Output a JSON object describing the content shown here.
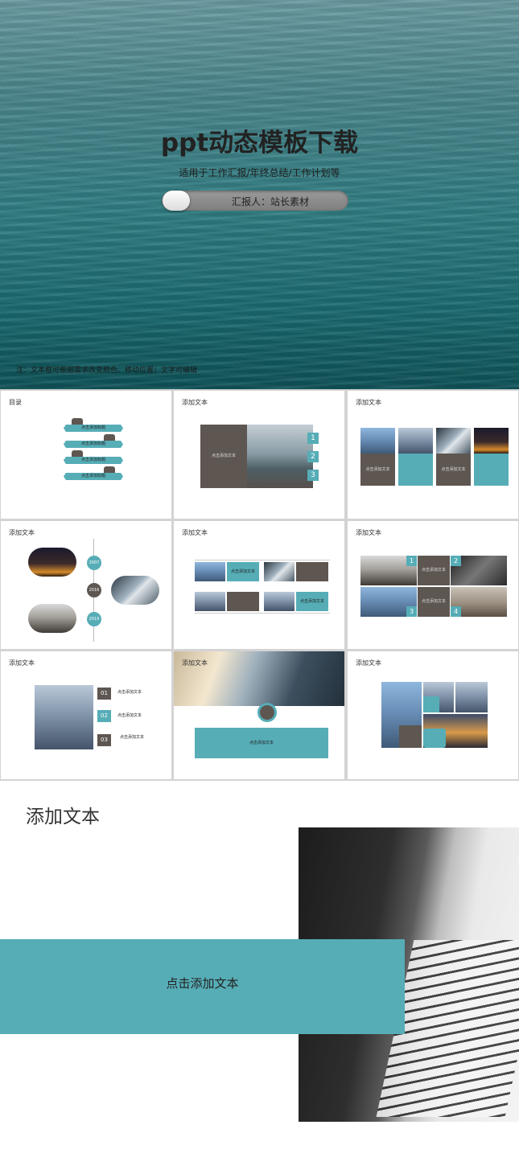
{
  "hero": {
    "title": "ppt动态模板下载",
    "subtitle": "适用于工作汇报/年终总结/工作计划等",
    "reporter": "汇报人：站长素材",
    "note": "注：文本框可根据需求改变颜色、移动位置；文字可编辑"
  },
  "slides": {
    "s1": {
      "label": "目录",
      "items": [
        "点击添加标题",
        "点击添加标题",
        "点击添加标题",
        "点击添加标题"
      ]
    },
    "s2": {
      "label": "添加文本",
      "box": "点击添加文本",
      "nums": [
        "1",
        "2",
        "3"
      ]
    },
    "s3": {
      "label": "添加文本",
      "boxes": [
        "点击添加文本",
        "点击添加文本"
      ]
    },
    "s4": {
      "label": "添加文本",
      "years": [
        "2007",
        "2016",
        "2019"
      ]
    },
    "s5": {
      "label": "添加文本",
      "boxes": [
        "点击添加文本",
        "点击添加文本"
      ]
    },
    "s6": {
      "label": "添加文本",
      "boxes": [
        "点击添加文本",
        "点击添加文本"
      ],
      "nums": [
        "1",
        "2",
        "3",
        "4"
      ]
    },
    "s7": {
      "label": "添加文本",
      "nums": [
        "01",
        "02",
        "03"
      ],
      "items": [
        "点击添加文本",
        "点击添加文本",
        "点击添加文本"
      ]
    },
    "s8": {
      "label": "添加文本",
      "box": "点击添加文本"
    },
    "s9": {
      "label": "添加文本"
    }
  },
  "big_slide": {
    "title": "添加文本",
    "band_text": "点击添加文本"
  },
  "colors": {
    "teal": "#56adb6",
    "brown": "#5e5651",
    "sea": "#2f7d82"
  }
}
